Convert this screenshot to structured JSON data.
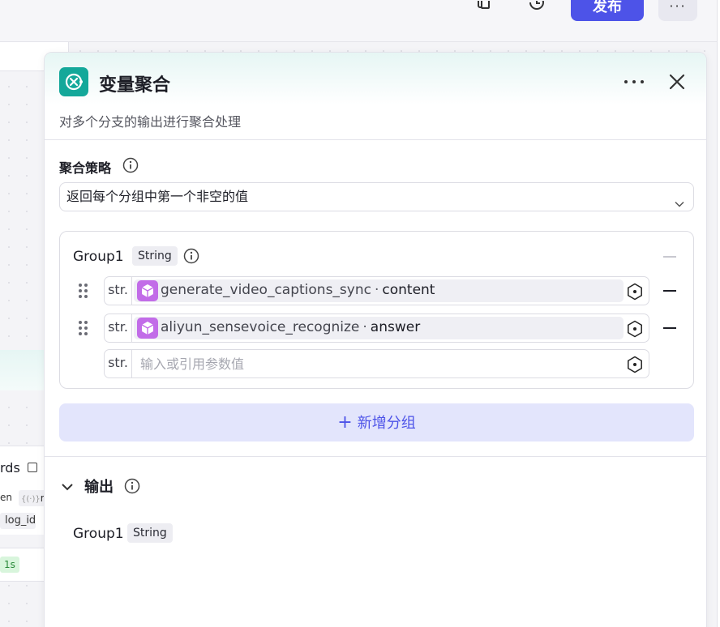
{
  "topbar": {
    "publish_label": "发布",
    "more_label": "···"
  },
  "canvas_fragments": {
    "node_text_suffix": "rds",
    "chip_en": "en",
    "chip_re": "re",
    "chip_logid": "log_id",
    "duration_badge": "1s"
  },
  "panel": {
    "title": "变量聚合",
    "description": "对多个分支的输出进行聚合处理",
    "strategy_label": "聚合策略",
    "strategy_value": "返回每个分组中第一个非空的值",
    "group": {
      "name": "Group1",
      "type": "String",
      "variables": [
        {
          "prefix": "str.",
          "node": "generate_video_captions_sync",
          "field": "content"
        },
        {
          "prefix": "str.",
          "node": "aliyun_sensevoice_recognize",
          "field": "answer"
        }
      ],
      "empty_input": {
        "prefix": "str.",
        "placeholder": "输入或引用参数值"
      }
    },
    "add_group_label": "新增分组",
    "output": {
      "title": "输出",
      "items": [
        {
          "name": "Group1",
          "type": "String"
        }
      ]
    }
  },
  "colors": {
    "accent": "#4d53e8",
    "node_icon": "#14a89a",
    "ref_icon": "#c26ce8"
  }
}
